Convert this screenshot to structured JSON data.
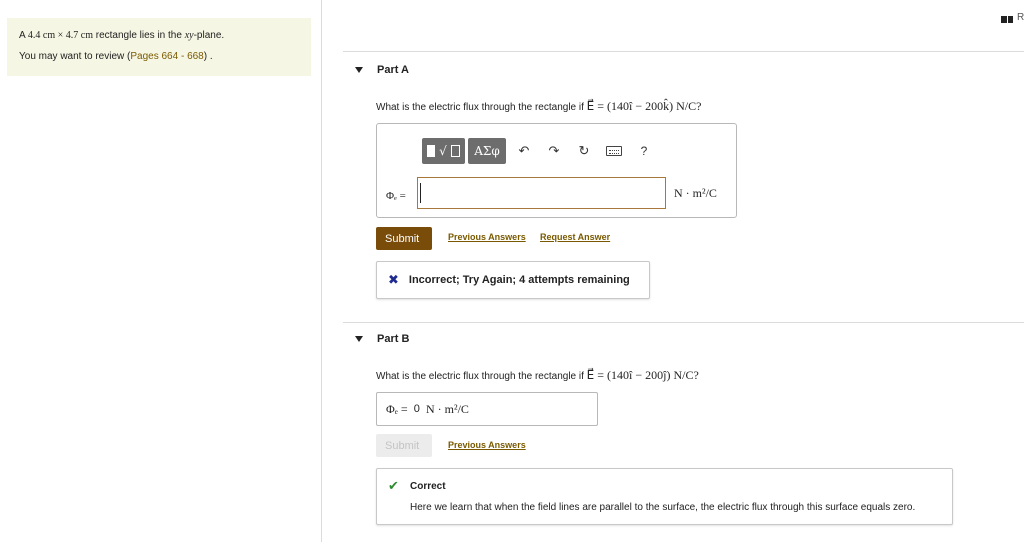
{
  "info": {
    "problem_prefix": "A ",
    "problem_math": "4.4 cm × 4.7 cm",
    "problem_mid": " rectangle lies in the ",
    "problem_plane": "xy",
    "problem_suffix": "-plane.",
    "review_prefix": "You may want to review (",
    "review_link": "Pages 664 - 668",
    "review_suffix": ") ."
  },
  "corner_text": "R",
  "part_a": {
    "title": "Part A",
    "question_prefix": "What is the electric flux through the rectangle if ",
    "question_math": "E⃗ = (140î − 200k̂) N/C?",
    "toolbar": {
      "templates_icon": "templates-icon",
      "symbols_label": "ΑΣφ",
      "undo_icon": "↶",
      "redo_icon": "↷",
      "reset_icon": "↻",
      "help_label": "?"
    },
    "input_label": "Φₑ =",
    "input_value": "",
    "unit": "N · m²/C",
    "submit_label": "Submit",
    "previous_answers": "Previous Answers",
    "request_answer": "Request Answer",
    "feedback_icon": "✖",
    "feedback_text": "Incorrect; Try Again; 4 attempts remaining"
  },
  "part_b": {
    "title": "Part B",
    "question_prefix": "What is the electric flux through the rectangle if ",
    "question_math": "E⃗ = (140î − 200ĵ) N/C?",
    "answer_label": "Φₑ =",
    "answer_value": "0",
    "answer_unit": "N · m²/C",
    "submit_label": "Submit",
    "previous_answers": "Previous Answers",
    "correct_icon": "✔",
    "correct_title": "Correct",
    "correct_message": "Here we learn that when the field lines are parallel to the surface, the electric flux through this surface equals zero."
  },
  "colors": {
    "info_bg": "#f6f6e4",
    "submit_bg": "#7a4c0a",
    "link": "#7a5a00",
    "input_border": "#a8773c",
    "incorrect_icon": "#1f2b8f",
    "correct_icon": "#2e8b2e"
  }
}
